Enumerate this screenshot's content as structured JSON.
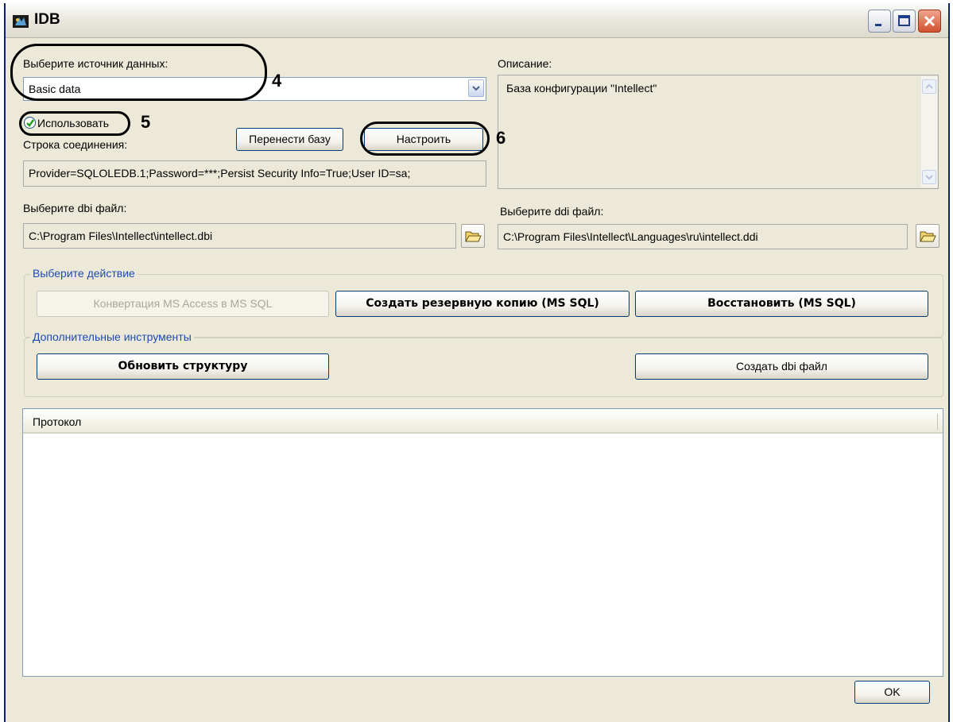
{
  "window": {
    "title": "IDB"
  },
  "source": {
    "label": "Выберите источник данных:",
    "value": "Basic data",
    "use_label": "Использовать",
    "use_checked": true,
    "connection_label": "Строка соединения:",
    "connection_string": "Provider=SQLOLEDB.1;Password=***;Persist Security Info=True;User ID=sa;"
  },
  "buttons": {
    "transfer": "Перенести базу",
    "configure": "Настроить"
  },
  "description": {
    "label": "Описание:",
    "text": "База конфигурации \"Intellect\""
  },
  "dbi": {
    "label": "Выберите dbi файл:",
    "value": "C:\\Program Files\\Intellect\\intellect.dbi"
  },
  "ddi": {
    "label": "Выберите ddi файл:",
    "value": "C:\\Program Files\\Intellect\\Languages\\ru\\intellect.ddi"
  },
  "actions": {
    "group_label": "Выберите действие",
    "convert": "Конвертация MS Access в MS SQL",
    "backup": "Создать резервную копию  (MS SQL)",
    "restore": "Восстановить (MS SQL)"
  },
  "tools": {
    "group_label": "Дополнительные инструменты",
    "update": "Обновить структуру",
    "create_dbi": "Создать dbi файл"
  },
  "protocol": {
    "header": "Протокол"
  },
  "ok": "OK",
  "annotations": [
    "4",
    "5",
    "6"
  ]
}
